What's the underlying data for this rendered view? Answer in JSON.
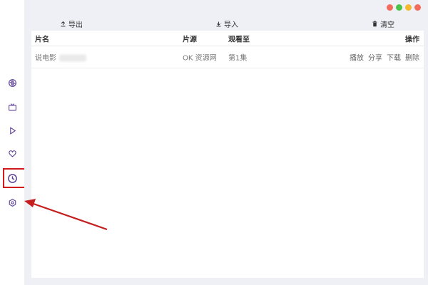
{
  "sidebar": {
    "items": [
      {
        "name": "aperture-icon"
      },
      {
        "name": "tv-icon"
      },
      {
        "name": "play-icon"
      },
      {
        "name": "heart-icon"
      },
      {
        "name": "clock-icon",
        "active": true
      },
      {
        "name": "settings-icon"
      }
    ]
  },
  "toolbar": {
    "export_label": "导出",
    "import_label": "导入",
    "clear_label": "清空"
  },
  "table": {
    "headers": {
      "name": "片名",
      "source": "片源",
      "watched": "观看至",
      "actions": "操作"
    },
    "rows": [
      {
        "name": "说电影",
        "source": "OK 资源网",
        "watched": "第1集",
        "actions": [
          "播放",
          "分享",
          "下载",
          "删除"
        ]
      }
    ]
  },
  "colors": {
    "accent": "#5b3e96",
    "highlight_box": "#d11a1a",
    "arrow": "#c41e1e",
    "window_close": "#f36b5a",
    "window_min": "#f5b82e",
    "window_max": "#4cc44a"
  }
}
